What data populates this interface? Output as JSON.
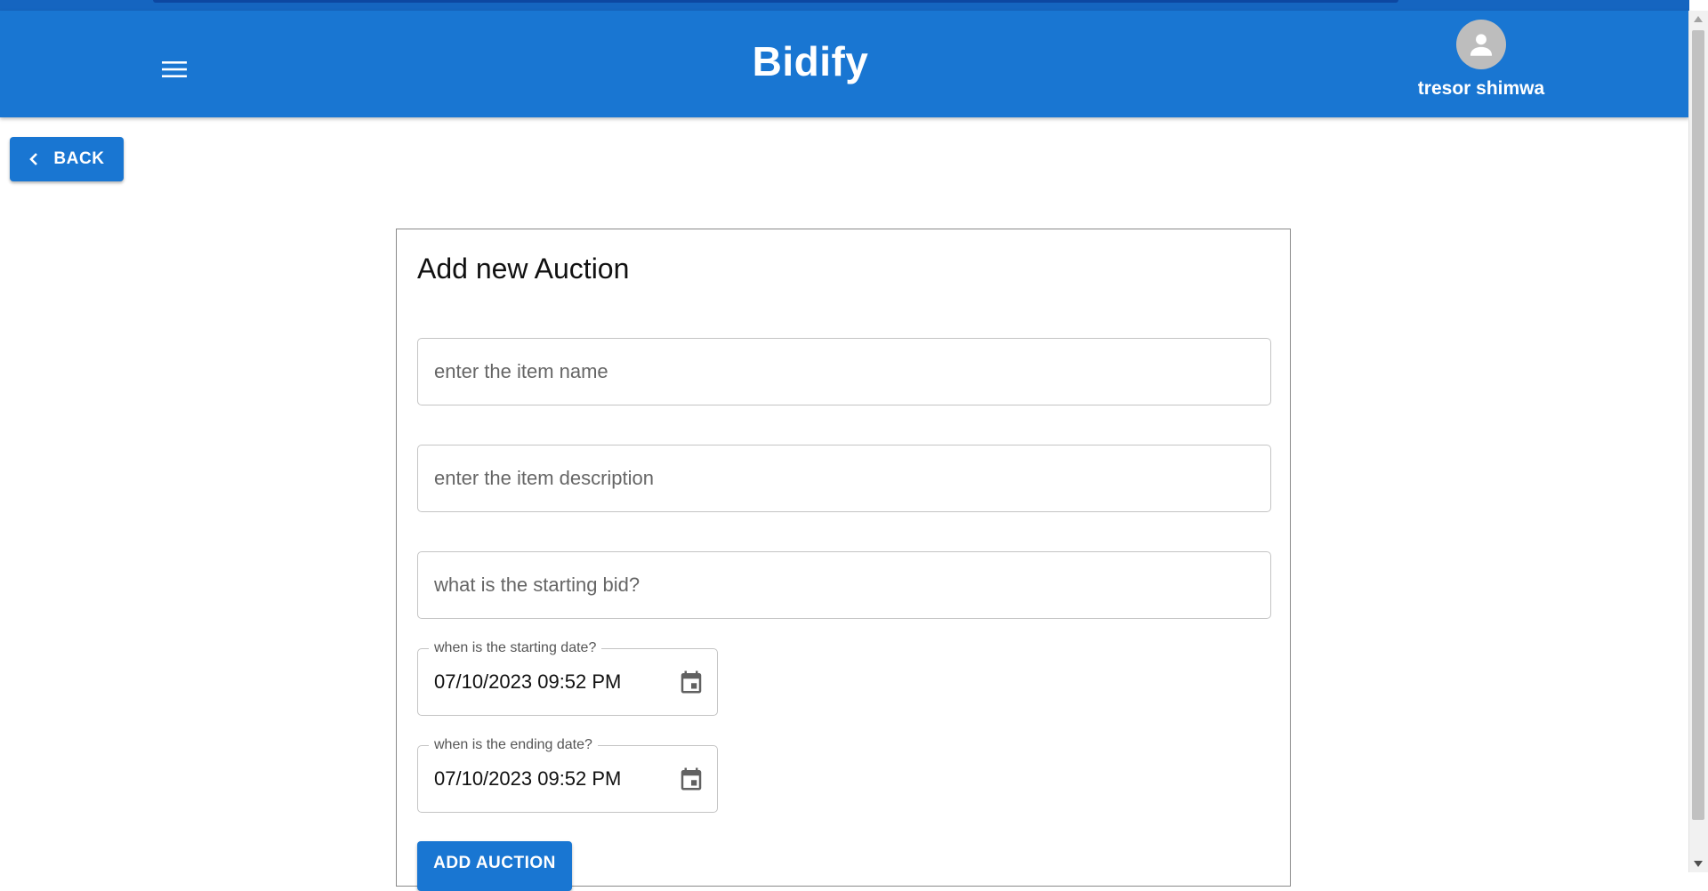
{
  "app": {
    "title": "Bidify",
    "user_name": "tresor shimwa"
  },
  "icons": {
    "menu": "menu-icon",
    "avatar": "account-circle-icon",
    "back": "chevron-left-icon",
    "calendar": "calendar-icon"
  },
  "colors": {
    "primary": "#1976d2",
    "appbar_strip": "#1565c0",
    "avatar_bg": "#bdbdbd"
  },
  "nav": {
    "back_label": "BACK"
  },
  "form": {
    "title": "Add new Auction",
    "item_name_placeholder": "enter the item name",
    "item_description_placeholder": "enter the item description",
    "starting_bid_placeholder": "what is the starting bid?",
    "start_date_label": "when is the starting date?",
    "start_date_value": "07/10/2023 09:52 PM",
    "end_date_label": "when is the ending date?",
    "end_date_value": "07/10/2023 09:52 PM",
    "submit_label": "ADD AUCTION"
  }
}
